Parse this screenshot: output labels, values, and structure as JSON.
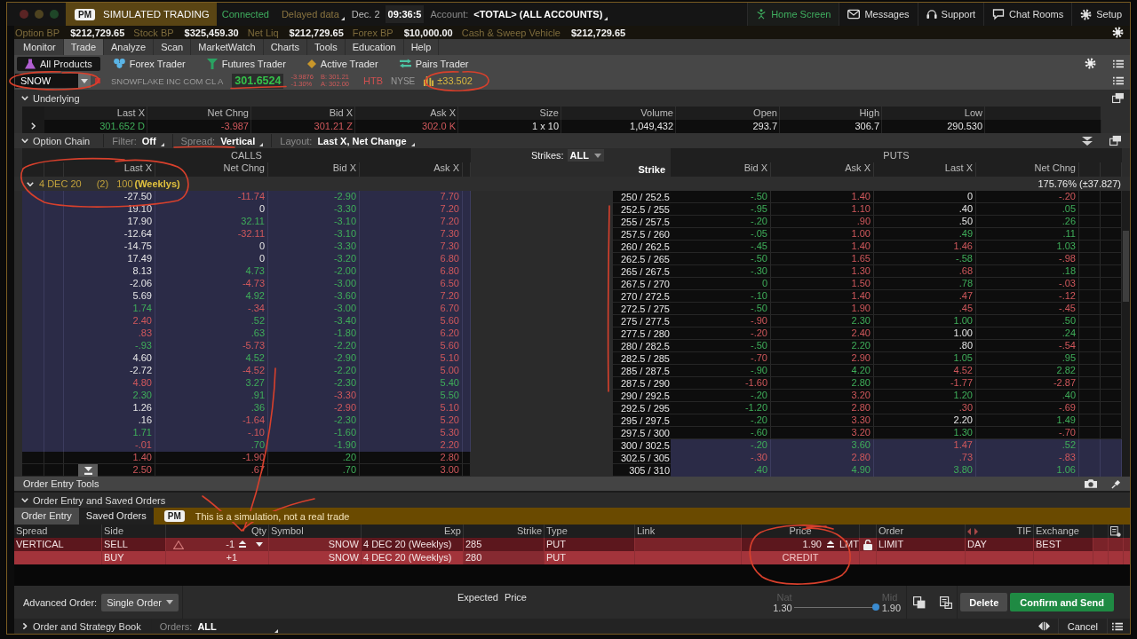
{
  "title_bar": {
    "badge": "PM",
    "mode": "SIMULATED TRADING",
    "connection": "Connected",
    "data_feed": "Delayed data",
    "date": "Dec. 2",
    "time": "09:36:5",
    "account_label": "Account:",
    "account": "<TOTAL> (ALL ACCOUNTS)",
    "links": [
      {
        "label": "Home Screen",
        "selected": true
      },
      {
        "label": "Messages",
        "selected": false
      },
      {
        "label": "Support",
        "selected": false
      },
      {
        "label": "Chat Rooms",
        "selected": false
      },
      {
        "label": "Setup",
        "selected": false
      }
    ]
  },
  "balances": [
    {
      "label": "Option BP",
      "value": "$212,729.65"
    },
    {
      "label": "Stock BP",
      "value": "$325,459.30"
    },
    {
      "label": "Net Liq",
      "value": "$212,729.65"
    },
    {
      "label": "Forex BP",
      "value": "$10,000.00"
    },
    {
      "label": "Cash & Sweep Vehicle",
      "value": "$212,729.65"
    }
  ],
  "menu": [
    {
      "label": "Monitor",
      "selected": false
    },
    {
      "label": "Trade",
      "selected": true
    },
    {
      "label": "Analyze",
      "selected": false
    },
    {
      "label": "Scan",
      "selected": false
    },
    {
      "label": "MarketWatch",
      "selected": false
    },
    {
      "label": "Charts",
      "selected": false
    },
    {
      "label": "Tools",
      "selected": false
    },
    {
      "label": "Education",
      "selected": false
    },
    {
      "label": "Help",
      "selected": false
    }
  ],
  "products": [
    {
      "label": "All Products",
      "selected": true
    },
    {
      "label": "Forex Trader",
      "selected": false
    },
    {
      "label": "Futures Trader",
      "selected": false
    },
    {
      "label": "Active Trader",
      "selected": false
    },
    {
      "label": "Pairs Trader",
      "selected": false
    }
  ],
  "quote": {
    "symbol": "SNOW",
    "company": "SNOWFLAKE INC COM CL A",
    "last": "301.6524",
    "change": "-3.9876",
    "change_pct": "-1.30%",
    "bid": "B: 301.21",
    "ask": "A: 302.00",
    "borrow": "HTB",
    "exchange": "NYSE",
    "expected_move": "±33.502"
  },
  "underlying": {
    "title": "Underlying",
    "expanded": true,
    "columns": [
      "Last X",
      "Net Chng",
      "Bid X",
      "Ask X",
      "Size",
      "Volume",
      "Open",
      "High",
      "Low"
    ],
    "values": [
      {
        "text": "301.652",
        "exchange": "D",
        "kind": "up"
      },
      {
        "text": "-3.987",
        "kind": "down"
      },
      {
        "text": "301.21",
        "exchange": "Z",
        "kind": "down"
      },
      {
        "text": "302.0",
        "exchange": "K",
        "kind": "down"
      },
      {
        "text": "1 x 10",
        "kind": "flat"
      },
      {
        "text": "1,049,432",
        "kind": "flat"
      },
      {
        "text": "293.7",
        "kind": "flat"
      },
      {
        "text": "306.7",
        "kind": "flat"
      },
      {
        "text": "290.530",
        "kind": "flat"
      }
    ]
  },
  "option_chain": {
    "title": "Option Chain",
    "expanded": true,
    "filters": [
      {
        "label": "Filter:",
        "value": "Off"
      },
      {
        "label": "Spread:",
        "value": "Vertical"
      },
      {
        "label": "Layout:",
        "value": "Last X, Net Change"
      }
    ],
    "calls_label": "CALLS",
    "puts_label": "PUTS",
    "strikes_label": "Strikes:",
    "strikes_value": "ALL",
    "call_columns": [
      "Last X",
      "Net Chng",
      "Bid X",
      "Ask X"
    ],
    "strike_column": "Strike",
    "put_columns": [
      "Bid X",
      "Ask X",
      "Last X",
      "Net Chng"
    ],
    "expiry": {
      "date": "4 DEC 20",
      "count": "(2)",
      "multiplier": "100",
      "tag": "(Weeklys)",
      "expanded": true,
      "volatility": "175.76% (±37.827)"
    },
    "rows": [
      {
        "strike": "250 / 252.5",
        "call_itm": true,
        "put_itm": false,
        "calls": [
          {
            "text": "-27.50",
            "kind": "flat"
          },
          {
            "text": "-11.74",
            "kind": "down"
          },
          {
            "text": "-2.90",
            "kind": "up"
          },
          {
            "text": "7.70",
            "kind": "down"
          }
        ],
        "puts": [
          {
            "text": "-.50",
            "kind": "up"
          },
          {
            "text": "1.40",
            "kind": "down"
          },
          {
            "text": "0",
            "kind": "flat"
          },
          {
            "text": "-.20",
            "kind": "down"
          }
        ]
      },
      {
        "strike": "252.5 / 255",
        "call_itm": true,
        "put_itm": false,
        "calls": [
          {
            "text": "19.10",
            "kind": "flat"
          },
          {
            "text": "0",
            "kind": "flat"
          },
          {
            "text": "-3.30",
            "kind": "up"
          },
          {
            "text": "7.20",
            "kind": "down"
          }
        ],
        "puts": [
          {
            "text": "-.95",
            "kind": "up"
          },
          {
            "text": "1.10",
            "kind": "down"
          },
          {
            "text": ".40",
            "kind": "flat"
          },
          {
            "text": ".05",
            "kind": "up"
          }
        ]
      },
      {
        "strike": "255 / 257.5",
        "call_itm": true,
        "put_itm": false,
        "calls": [
          {
            "text": "17.90",
            "kind": "flat"
          },
          {
            "text": "32.11",
            "kind": "up"
          },
          {
            "text": "-3.10",
            "kind": "up"
          },
          {
            "text": "7.20",
            "kind": "down"
          }
        ],
        "puts": [
          {
            "text": "-.20",
            "kind": "up"
          },
          {
            "text": ".90",
            "kind": "down"
          },
          {
            "text": ".50",
            "kind": "flat"
          },
          {
            "text": ".26",
            "kind": "up"
          }
        ]
      },
      {
        "strike": "257.5 / 260",
        "call_itm": true,
        "put_itm": false,
        "calls": [
          {
            "text": "-12.64",
            "kind": "flat"
          },
          {
            "text": "-32.11",
            "kind": "down"
          },
          {
            "text": "-3.10",
            "kind": "up"
          },
          {
            "text": "7.30",
            "kind": "down"
          }
        ],
        "puts": [
          {
            "text": "-.05",
            "kind": "up"
          },
          {
            "text": "1.00",
            "kind": "down"
          },
          {
            "text": ".49",
            "kind": "up"
          },
          {
            "text": ".11",
            "kind": "up"
          }
        ]
      },
      {
        "strike": "260 / 262.5",
        "call_itm": true,
        "put_itm": false,
        "calls": [
          {
            "text": "-14.75",
            "kind": "flat"
          },
          {
            "text": "0",
            "kind": "flat"
          },
          {
            "text": "-3.30",
            "kind": "up"
          },
          {
            "text": "7.30",
            "kind": "down"
          }
        ],
        "puts": [
          {
            "text": "-.45",
            "kind": "up"
          },
          {
            "text": "1.40",
            "kind": "down"
          },
          {
            "text": "1.46",
            "kind": "down"
          },
          {
            "text": "1.03",
            "kind": "up"
          }
        ]
      },
      {
        "strike": "262.5 / 265",
        "call_itm": true,
        "put_itm": false,
        "calls": [
          {
            "text": "17.49",
            "kind": "flat"
          },
          {
            "text": "0",
            "kind": "flat"
          },
          {
            "text": "-3.20",
            "kind": "up"
          },
          {
            "text": "6.80",
            "kind": "down"
          }
        ],
        "puts": [
          {
            "text": "-.50",
            "kind": "up"
          },
          {
            "text": "1.65",
            "kind": "down"
          },
          {
            "text": "-.58",
            "kind": "up"
          },
          {
            "text": "-.98",
            "kind": "down"
          }
        ]
      },
      {
        "strike": "265 / 267.5",
        "call_itm": true,
        "put_itm": false,
        "calls": [
          {
            "text": "8.13",
            "kind": "flat"
          },
          {
            "text": "4.73",
            "kind": "up"
          },
          {
            "text": "-2.00",
            "kind": "up"
          },
          {
            "text": "6.80",
            "kind": "down"
          }
        ],
        "puts": [
          {
            "text": "-.30",
            "kind": "up"
          },
          {
            "text": "1.30",
            "kind": "down"
          },
          {
            "text": ".68",
            "kind": "down"
          },
          {
            "text": ".18",
            "kind": "up"
          }
        ]
      },
      {
        "strike": "267.5 / 270",
        "call_itm": true,
        "put_itm": false,
        "calls": [
          {
            "text": "-2.06",
            "kind": "flat"
          },
          {
            "text": "-4.73",
            "kind": "down"
          },
          {
            "text": "-3.00",
            "kind": "up"
          },
          {
            "text": "6.50",
            "kind": "down"
          }
        ],
        "puts": [
          {
            "text": "0",
            "kind": "up"
          },
          {
            "text": "1.50",
            "kind": "down"
          },
          {
            "text": ".78",
            "kind": "up"
          },
          {
            "text": "-.03",
            "kind": "down"
          }
        ]
      },
      {
        "strike": "270 / 272.5",
        "call_itm": true,
        "put_itm": false,
        "calls": [
          {
            "text": "5.69",
            "kind": "flat"
          },
          {
            "text": "4.92",
            "kind": "up"
          },
          {
            "text": "-3.60",
            "kind": "up"
          },
          {
            "text": "7.20",
            "kind": "down"
          }
        ],
        "puts": [
          {
            "text": "-.10",
            "kind": "up"
          },
          {
            "text": "1.40",
            "kind": "down"
          },
          {
            "text": ".47",
            "kind": "down"
          },
          {
            "text": "-.12",
            "kind": "down"
          }
        ]
      },
      {
        "strike": "272.5 / 275",
        "call_itm": true,
        "put_itm": false,
        "calls": [
          {
            "text": "1.74",
            "kind": "up"
          },
          {
            "text": "-.34",
            "kind": "down"
          },
          {
            "text": "-3.00",
            "kind": "up"
          },
          {
            "text": "6.70",
            "kind": "down"
          }
        ],
        "puts": [
          {
            "text": "-.50",
            "kind": "up"
          },
          {
            "text": "1.90",
            "kind": "down"
          },
          {
            "text": ".45",
            "kind": "down"
          },
          {
            "text": "-.45",
            "kind": "down"
          }
        ]
      },
      {
        "strike": "275 / 277.5",
        "call_itm": true,
        "put_itm": false,
        "calls": [
          {
            "text": "2.40",
            "kind": "down"
          },
          {
            "text": ".52",
            "kind": "up"
          },
          {
            "text": "-3.40",
            "kind": "up"
          },
          {
            "text": "5.60",
            "kind": "down"
          }
        ],
        "puts": [
          {
            "text": "-.90",
            "kind": "down"
          },
          {
            "text": "2.30",
            "kind": "up"
          },
          {
            "text": "1.00",
            "kind": "up"
          },
          {
            "text": ".50",
            "kind": "up"
          }
        ]
      },
      {
        "strike": "277.5 / 280",
        "call_itm": true,
        "put_itm": false,
        "calls": [
          {
            "text": ".83",
            "kind": "down"
          },
          {
            "text": ".63",
            "kind": "up"
          },
          {
            "text": "-1.80",
            "kind": "up"
          },
          {
            "text": "6.20",
            "kind": "down"
          }
        ],
        "puts": [
          {
            "text": "-.20",
            "kind": "down"
          },
          {
            "text": "2.40",
            "kind": "down"
          },
          {
            "text": "1.00",
            "kind": "flat"
          },
          {
            "text": ".24",
            "kind": "up"
          }
        ]
      },
      {
        "strike": "280 / 282.5",
        "call_itm": true,
        "put_itm": false,
        "calls": [
          {
            "text": "-.93",
            "kind": "up"
          },
          {
            "text": "-5.73",
            "kind": "down"
          },
          {
            "text": "-2.20",
            "kind": "up"
          },
          {
            "text": "5.60",
            "kind": "down"
          }
        ],
        "puts": [
          {
            "text": "-.50",
            "kind": "up"
          },
          {
            "text": "2.20",
            "kind": "up"
          },
          {
            "text": ".80",
            "kind": "flat"
          },
          {
            "text": "-.54",
            "kind": "down"
          }
        ]
      },
      {
        "strike": "282.5 / 285",
        "call_itm": true,
        "put_itm": false,
        "calls": [
          {
            "text": "4.60",
            "kind": "flat"
          },
          {
            "text": "4.52",
            "kind": "up"
          },
          {
            "text": "-2.90",
            "kind": "up"
          },
          {
            "text": "5.10",
            "kind": "down"
          }
        ],
        "puts": [
          {
            "text": "-.70",
            "kind": "down"
          },
          {
            "text": "2.90",
            "kind": "down"
          },
          {
            "text": "1.05",
            "kind": "up"
          },
          {
            "text": ".95",
            "kind": "up"
          }
        ]
      },
      {
        "strike": "285 / 287.5",
        "call_itm": true,
        "put_itm": false,
        "calls": [
          {
            "text": "-2.72",
            "kind": "flat"
          },
          {
            "text": "-4.52",
            "kind": "down"
          },
          {
            "text": "-2.20",
            "kind": "up"
          },
          {
            "text": "5.00",
            "kind": "down"
          }
        ],
        "puts": [
          {
            "text": "-.90",
            "kind": "up"
          },
          {
            "text": "4.20",
            "kind": "up"
          },
          {
            "text": "4.52",
            "kind": "down"
          },
          {
            "text": "2.82",
            "kind": "up"
          }
        ]
      },
      {
        "strike": "287.5 / 290",
        "call_itm": true,
        "put_itm": false,
        "calls": [
          {
            "text": "4.80",
            "kind": "down"
          },
          {
            "text": "3.27",
            "kind": "up"
          },
          {
            "text": "-2.30",
            "kind": "up"
          },
          {
            "text": "5.40",
            "kind": "up"
          }
        ],
        "puts": [
          {
            "text": "-1.60",
            "kind": "down"
          },
          {
            "text": "2.80",
            "kind": "up"
          },
          {
            "text": "-1.77",
            "kind": "down"
          },
          {
            "text": "-2.87",
            "kind": "down"
          }
        ]
      },
      {
        "strike": "290 / 292.5",
        "call_itm": true,
        "put_itm": false,
        "calls": [
          {
            "text": "2.30",
            "kind": "up"
          },
          {
            "text": ".91",
            "kind": "up"
          },
          {
            "text": "-3.30",
            "kind": "down"
          },
          {
            "text": "5.50",
            "kind": "up"
          }
        ],
        "puts": [
          {
            "text": "-.20",
            "kind": "up"
          },
          {
            "text": "3.20",
            "kind": "down"
          },
          {
            "text": "1.20",
            "kind": "up"
          },
          {
            "text": ".40",
            "kind": "up"
          }
        ]
      },
      {
        "strike": "292.5 / 295",
        "call_itm": true,
        "put_itm": false,
        "calls": [
          {
            "text": "1.26",
            "kind": "flat"
          },
          {
            "text": ".36",
            "kind": "up"
          },
          {
            "text": "-2.90",
            "kind": "down"
          },
          {
            "text": "5.10",
            "kind": "down"
          }
        ],
        "puts": [
          {
            "text": "-1.20",
            "kind": "up"
          },
          {
            "text": "2.80",
            "kind": "down"
          },
          {
            "text": ".30",
            "kind": "down"
          },
          {
            "text": "-.69",
            "kind": "down"
          }
        ]
      },
      {
        "strike": "295 / 297.5",
        "call_itm": true,
        "put_itm": false,
        "calls": [
          {
            "text": ".16",
            "kind": "flat"
          },
          {
            "text": "-1.64",
            "kind": "down"
          },
          {
            "text": "-2.30",
            "kind": "up"
          },
          {
            "text": "5.20",
            "kind": "down"
          }
        ],
        "puts": [
          {
            "text": "-.20",
            "kind": "up"
          },
          {
            "text": "3.30",
            "kind": "down"
          },
          {
            "text": "2.20",
            "kind": "flat"
          },
          {
            "text": "1.49",
            "kind": "up"
          }
        ]
      },
      {
        "strike": "297.5 / 300",
        "call_itm": true,
        "put_itm": false,
        "calls": [
          {
            "text": "1.71",
            "kind": "up"
          },
          {
            "text": "-.10",
            "kind": "down"
          },
          {
            "text": "-1.60",
            "kind": "up"
          },
          {
            "text": "5.30",
            "kind": "down"
          }
        ],
        "puts": [
          {
            "text": "-.60",
            "kind": "up"
          },
          {
            "text": "3.20",
            "kind": "down"
          },
          {
            "text": "1.30",
            "kind": "up"
          },
          {
            "text": "-.70",
            "kind": "down"
          }
        ]
      },
      {
        "strike": "300 / 302.5",
        "call_itm": true,
        "put_itm": true,
        "calls": [
          {
            "text": "-.01",
            "kind": "down"
          },
          {
            "text": ".70",
            "kind": "up"
          },
          {
            "text": "-1.90",
            "kind": "up"
          },
          {
            "text": "2.20",
            "kind": "down"
          }
        ],
        "puts": [
          {
            "text": "-.20",
            "kind": "up"
          },
          {
            "text": "3.60",
            "kind": "up"
          },
          {
            "text": "1.47",
            "kind": "down"
          },
          {
            "text": ".52",
            "kind": "up"
          }
        ]
      },
      {
        "strike": "302.5 / 305",
        "call_itm": false,
        "put_itm": true,
        "calls": [
          {
            "text": "1.40",
            "kind": "down"
          },
          {
            "text": "-1.90",
            "kind": "down"
          },
          {
            "text": ".20",
            "kind": "up"
          },
          {
            "text": "2.80",
            "kind": "down"
          }
        ],
        "puts": [
          {
            "text": "-.30",
            "kind": "down"
          },
          {
            "text": "2.80",
            "kind": "down"
          },
          {
            "text": ".73",
            "kind": "down"
          },
          {
            "text": "-.83",
            "kind": "down"
          }
        ]
      },
      {
        "strike": "305 / 310",
        "call_itm": false,
        "put_itm": true,
        "calls": [
          {
            "text": "2.50",
            "kind": "down"
          },
          {
            "text": ".67",
            "kind": "down"
          },
          {
            "text": ".70",
            "kind": "up"
          },
          {
            "text": "3.00",
            "kind": "down"
          }
        ],
        "puts": [
          {
            "text": ".40",
            "kind": "up"
          },
          {
            "text": "4.90",
            "kind": "up"
          },
          {
            "text": "3.80",
            "kind": "up"
          },
          {
            "text": "1.06",
            "kind": "up"
          }
        ]
      }
    ]
  },
  "order_entry": {
    "tools_title": "Order Entry Tools",
    "title": "Order Entry and Saved Orders",
    "expanded": true,
    "tabs": [
      {
        "label": "Order Entry",
        "selected": true
      },
      {
        "label": "Saved Orders",
        "selected": false
      }
    ],
    "notice": {
      "badge": "PM",
      "text": "This is a simulation, not a real trade"
    },
    "columns": [
      "Spread",
      "Side",
      "Qty",
      "Symbol",
      "Exp",
      "Strike",
      "Type",
      "Link",
      "Price",
      "Order",
      "TIF",
      "Exchange"
    ],
    "legs": [
      {
        "spread": "VERTICAL",
        "side": "SELL",
        "qty": "-1",
        "symbol": "SNOW",
        "exp": "4 DEC 20 (Weeklys)",
        "strike": "285",
        "type": "PUT",
        "price": "1.90",
        "price_type": "LMT",
        "order": "LIMIT",
        "tif": "DAY",
        "exchange": "BEST"
      },
      {
        "side": "BUY",
        "qty": "+1",
        "symbol": "SNOW",
        "exp": "4 DEC 20 (Weeklys)",
        "strike": "280",
        "type": "PUT",
        "price": "CREDIT"
      }
    ],
    "advanced_label": "Advanced Order:",
    "advanced_value": "Single Order",
    "expected_price": "Expected Price",
    "slider": {
      "low_label": "Nat",
      "low": "1.30",
      "high_label": "Mid",
      "high": "1.90",
      "level": 1
    },
    "buttons": [
      {
        "label": "Delete",
        "kind": "secondary"
      },
      {
        "label": "Confirm and Send",
        "kind": "primary"
      }
    ]
  },
  "book": {
    "title": "Order and Strategy Book",
    "expanded": false,
    "orders_label": "Orders:",
    "orders_value": "ALL",
    "cancel": "Cancel"
  }
}
